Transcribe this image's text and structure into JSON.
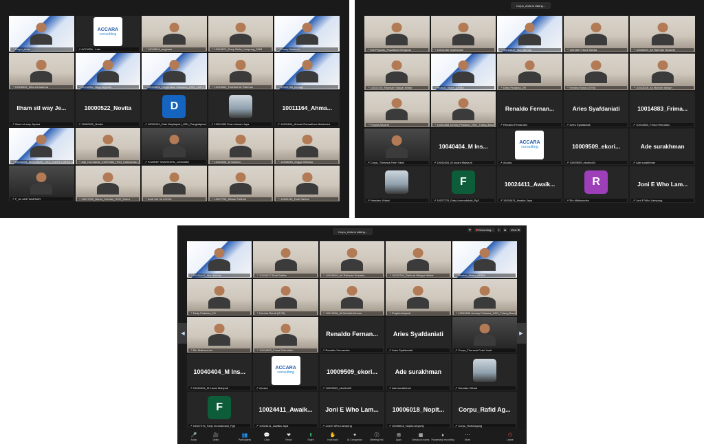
{
  "windows": {
    "top_left": {
      "tiles": [
        {
          "type": "video",
          "style": "blue",
          "label": "Corpu_Anita"
        },
        {
          "type": "logo",
          "label": "ACCARA - Lala"
        },
        {
          "type": "video",
          "style": "",
          "label": "10008518_angkasa"
        },
        {
          "type": "video",
          "style": "",
          "label": "10018874_Dony Setia_Lampung_5363"
        },
        {
          "type": "video",
          "style": "blue",
          "label": "Fenny Marlianti"
        },
        {
          "type": "video",
          "style": "",
          "label": "10008625_fitria.edi.sahrina"
        },
        {
          "type": "video",
          "style": "blue",
          "label": "ACCARA - Bayu Argento"
        },
        {
          "type": "video",
          "style": "blue",
          "label": "10004896_Dingkrakan Setiawan_HSH_12873"
        },
        {
          "type": "video",
          "style": "",
          "label": "10015869_Fadhilah Ar Rahman"
        },
        {
          "type": "video",
          "style": "blue",
          "label": "10020766_ira.sapi"
        },
        {
          "type": "name",
          "name": "Ilham stl way Je...",
          "label": "Ilham stl way Jepara"
        },
        {
          "type": "name",
          "name": "10000522_Novita",
          "label": "10000522_Novita"
        },
        {
          "type": "avatar",
          "letter": "D",
          "color": "#1565c0",
          "label": "10009131_Dian Mayliaputri_HSH_Pangkalpinang"
        },
        {
          "type": "photo",
          "label": "10001262 Evan Irawan Jaya"
        },
        {
          "type": "name",
          "name": "10011164_Ahma...",
          "label": "10011164_Ahmad Ramadhan Mahendra"
        },
        {
          "type": "video",
          "style": "blue",
          "label": "10016104_MOHAMAD_HSG_HARRI HAFAS 6689"
        },
        {
          "type": "video",
          "style": "",
          "label": "Adji_Kurniawan_10073465_HSG_Kalimantan_887"
        },
        {
          "type": "video",
          "style": "dark",
          "label": "SYARIEF SHARKIRIN_10001585"
        },
        {
          "type": "video",
          "style": "",
          "label": "10016253_M Subhan"
        },
        {
          "type": "video",
          "style": "",
          "label": "10006850_Angga Wibowo"
        },
        {
          "type": "video",
          "style": "dark",
          "label": "P_AL ADE WARNAR"
        },
        {
          "type": "video",
          "style": "",
          "label": "10017099_Bahar_Kendari_HSG_Suhra"
        },
        {
          "type": "video",
          "style": "",
          "label": "Andi Jufri di LOKAL"
        },
        {
          "type": "video",
          "style": "",
          "label": "10007753_Ikhsan Fadhali"
        },
        {
          "type": "video",
          "style": "",
          "label": "10002114_Rudi Santos"
        }
      ]
    },
    "top_right": {
      "talking": "Corpu_Anita is talking...",
      "tiles": [
        {
          "type": "video",
          "style": "",
          "label": "Edi Priyanto_Pusdiksar Bengkulu"
        },
        {
          "type": "video",
          "style": "",
          "label": "10014450 Syamsudin"
        },
        {
          "type": "video",
          "style": "blue",
          "label": "10016447_Muh Muhtar"
        },
        {
          "type": "video",
          "style": "",
          "label": "10016677 Budi Sahita"
        },
        {
          "type": "video",
          "style": "",
          "label": "10028929_Ari Rahman Susanto"
        },
        {
          "type": "video",
          "style": "",
          "label": "10002700_Rahmat Hidayat Ikhtiar"
        },
        {
          "type": "video",
          "style": "blue",
          "label": "Rivaldo_Ilham_ARBM"
        },
        {
          "type": "video",
          "style": "",
          "label": "Dedy Pratama_2H"
        },
        {
          "type": "video",
          "style": "",
          "label": "Hendra Randi (GYM)"
        },
        {
          "type": "video",
          "style": "",
          "label": "10013028_Ali Muhidin Ikhsan"
        },
        {
          "type": "video",
          "style": "",
          "label": "Purpita Ariyanti"
        },
        {
          "type": "video",
          "style": "",
          "label": "10002868 Jemmy Pratama_HSG_Tulang Bawang"
        },
        {
          "type": "name",
          "name": "Renaldo Fernan...",
          "label": "Renaldo Fernandes"
        },
        {
          "type": "name",
          "name": "Aries Syafdaniati",
          "label": "Aries Syafdaniati"
        },
        {
          "type": "name",
          "name": "10014883_Frima...",
          "label": "10014883_Frima Februdian"
        },
        {
          "type": "video",
          "style": "dark",
          "label": "Corpu_Theresia Febri Yanti"
        },
        {
          "type": "name",
          "name": "10040404_M Ins...",
          "label": "10040404_M Insani Mahyudi"
        },
        {
          "type": "logo",
          "label": "Accara"
        },
        {
          "type": "name",
          "name": "10009509_ekori...",
          "label": "10009509_ekoriko83"
        },
        {
          "type": "name",
          "name": "Ade surakhman",
          "label": "Ade surakhman"
        },
        {
          "type": "photo",
          "label": "Hamdan Virlawi"
        },
        {
          "type": "avatar",
          "letter": "F",
          "color": "#0d5c3a",
          "label": "10027276_Fady Inrumahdoki_Pg3"
        },
        {
          "type": "name",
          "name": "10024411_Awaik...",
          "label": "10024411_Awaika Jaya"
        },
        {
          "type": "avatar",
          "letter": "R",
          "color": "#9c3fb8",
          "label": "Rio Malissumbo"
        },
        {
          "type": "name",
          "name": "Joni E Who Lam...",
          "label": "Joni E Who Lampung"
        }
      ]
    },
    "bottom": {
      "talking": "Corpu_Anita is talking...",
      "recording": "Recording...",
      "view": "View",
      "page_left": "1/2",
      "page_right": "2/2",
      "tiles": [
        {
          "type": "video",
          "style": "blue",
          "label": "10016447_Muh Muhtar"
        },
        {
          "type": "video",
          "style": "",
          "label": "10016677 Budi Sahita"
        },
        {
          "type": "video",
          "style": "",
          "label": "10028929_Ari Rahman Susanto"
        },
        {
          "type": "video",
          "style": "",
          "label": "10002700_Rahmat Hidayat Ikhtiar"
        },
        {
          "type": "video",
          "style": "blue",
          "label": "Rivaldo_Ilham_ARBM"
        },
        {
          "type": "video",
          "style": "",
          "label": "Dedy Pratama_2H"
        },
        {
          "type": "video",
          "style": "",
          "label": "Hendra Randi (GYM)"
        },
        {
          "type": "video",
          "style": "",
          "label": "10013028_Ali Muhidin Ikhsan"
        },
        {
          "type": "video",
          "style": "",
          "label": "Purpita Ariyanti"
        },
        {
          "type": "video",
          "style": "",
          "label": "10002868 Jemmy Pratama_HSG_Tulang Bawang"
        },
        {
          "type": "video",
          "style": "",
          "label": "Rio Malissumbo"
        },
        {
          "type": "video",
          "style": "",
          "label": "10014883_Frima Februdian"
        },
        {
          "type": "name",
          "name": "Renaldo Fernan...",
          "label": "Renaldo Fernandes"
        },
        {
          "type": "name",
          "name": "Aries Syafdaniati",
          "label": "Aries Syafdaniati"
        },
        {
          "type": "video",
          "style": "dark",
          "label": "Corpu_Theresia Febri Yanti"
        },
        {
          "type": "name",
          "name": "10040404_M Ins...",
          "label": "10040404_M Insani Mahyudi"
        },
        {
          "type": "logo",
          "label": "Accara"
        },
        {
          "type": "name",
          "name": "10009509_ekori...",
          "label": "10009509_ekoriko83"
        },
        {
          "type": "name",
          "name": "Ade surakhman",
          "label": "Ade surakhman"
        },
        {
          "type": "photo",
          "label": "Hamdan Virlawi"
        },
        {
          "type": "avatar",
          "letter": "F",
          "color": "#0d5c3a",
          "label": "10027276_Fady Inrumahdoki_Pg3"
        },
        {
          "type": "name",
          "name": "10024411_Awaik...",
          "label": "10024411_Awaika Jaya"
        },
        {
          "type": "name",
          "name": "Joni E Who Lam...",
          "label": "Joni E Who Lampung"
        },
        {
          "type": "name",
          "name": "10006018_Nopit...",
          "label": "10006018_Nopita Ariyanty"
        },
        {
          "type": "name",
          "name": "Corpu_Rafid Ag...",
          "label": "Corpu_Rafid Agung"
        }
      ],
      "toolbar": [
        {
          "icon": "🎤",
          "label": "Audio",
          "name": "audio-button",
          "cls": "red"
        },
        {
          "icon": "🎥",
          "label": "Video",
          "name": "video-button",
          "cls": "red"
        },
        {
          "icon": "👥",
          "label": "Participants",
          "name": "participants-button",
          "cls": ""
        },
        {
          "icon": "💬",
          "label": "Chat",
          "name": "chat-button",
          "cls": ""
        },
        {
          "icon": "❤",
          "label": "React",
          "name": "react-button",
          "cls": ""
        },
        {
          "icon": "⬆",
          "label": "Share",
          "name": "share-button",
          "cls": "green"
        },
        {
          "icon": "✋",
          "label": "Host tools",
          "name": "host-tools-button",
          "cls": ""
        },
        {
          "icon": "✦",
          "label": "AI Companion",
          "name": "ai-companion-button",
          "cls": ""
        },
        {
          "icon": "ⓘ",
          "label": "Meeting info",
          "name": "meeting-info-button",
          "cls": ""
        },
        {
          "icon": "⊞",
          "label": "Apps",
          "name": "apps-button",
          "cls": ""
        },
        {
          "icon": "▦",
          "label": "Breakout rooms",
          "name": "breakout-rooms-button",
          "cls": ""
        },
        {
          "icon": "⏸",
          "label": "Pause/stop recording",
          "name": "recording-button",
          "cls": ""
        },
        {
          "icon": "⋯",
          "label": "More",
          "name": "more-button",
          "cls": ""
        },
        {
          "icon": "⏻",
          "label": "Leave",
          "name": "leave-button",
          "cls": "red"
        }
      ]
    }
  },
  "logo_text": {
    "line1": "ACCARA",
    "line2": "consulting"
  }
}
